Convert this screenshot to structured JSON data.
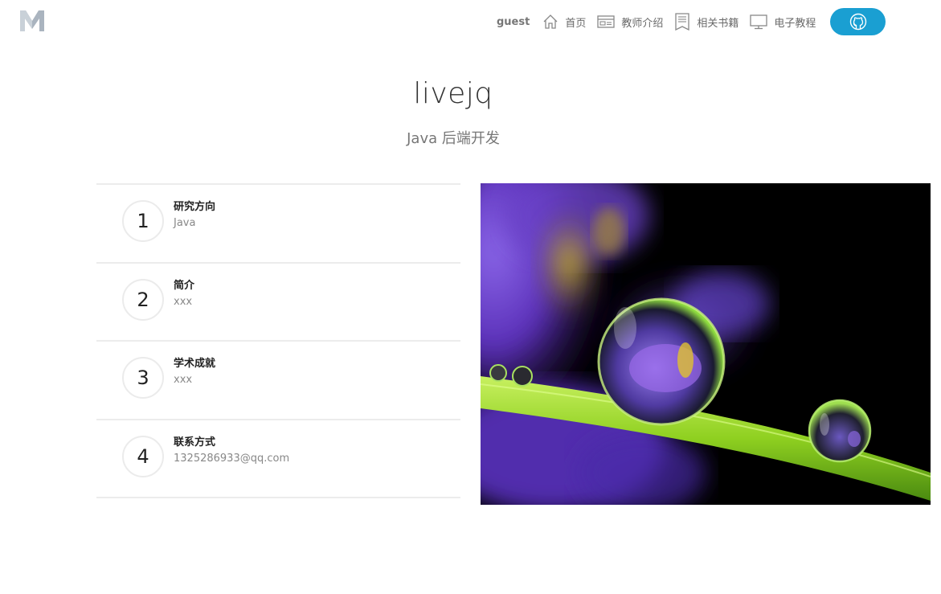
{
  "header": {
    "user": "guest",
    "nav": [
      {
        "label": "首页",
        "icon": "home-icon"
      },
      {
        "label": "教师介绍",
        "icon": "id-card-icon"
      },
      {
        "label": "相关书籍",
        "icon": "book-icon"
      },
      {
        "label": "电子教程",
        "icon": "monitor-icon"
      }
    ],
    "github_icon": "github-icon",
    "accent": "#1a9fd2"
  },
  "hero": {
    "title": "livejq",
    "subtitle": "Java 后端开发"
  },
  "info": [
    {
      "num": "1",
      "title": "研究方向",
      "value": "Java"
    },
    {
      "num": "2",
      "title": "简介",
      "value": "xxx"
    },
    {
      "num": "3",
      "title": "学术成就",
      "value": "xxx"
    },
    {
      "num": "4",
      "title": "联系方式",
      "value": "1325286933@qq.com"
    }
  ]
}
